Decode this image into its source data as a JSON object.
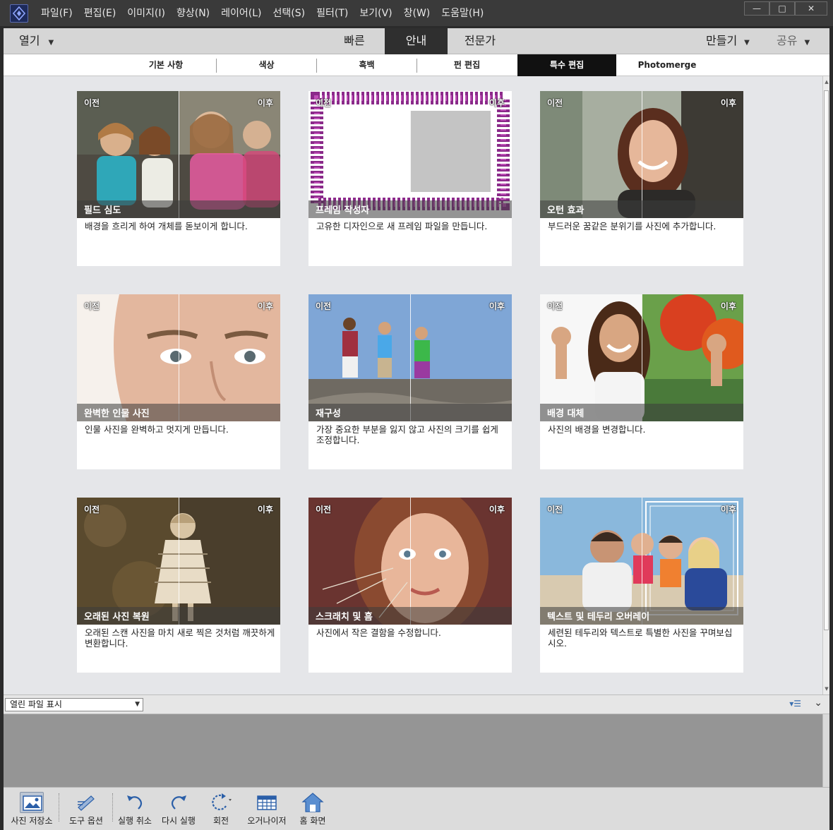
{
  "menu": [
    "파일(F)",
    "편집(E)",
    "이미지(I)",
    "향상(N)",
    "레이어(L)",
    "선택(S)",
    "필터(T)",
    "보기(V)",
    "창(W)",
    "도움말(H)"
  ],
  "window_controls": {
    "minimize": "—",
    "maximize": "□",
    "close": "✕"
  },
  "modebar": {
    "open": "열기",
    "tabs": [
      "빠른",
      "안내",
      "전문가"
    ],
    "active_tab": "안내",
    "create": "만들기",
    "share": "공유"
  },
  "subtabs": [
    "기본 사항",
    "색상",
    "흑백",
    "펀 편집",
    "특수 편집",
    "Photomerge"
  ],
  "active_subtab": "특수 편집",
  "card_labels": {
    "before": "이전",
    "after": "이후"
  },
  "cards": [
    {
      "title": "필드 심도",
      "desc": "배경을 흐리게 하여 개체를 돋보이게 합니다."
    },
    {
      "title": "프레임 작성자",
      "desc": "고유한 디자인으로 새 프레임 파일을 만듭니다."
    },
    {
      "title": "오턴 효과",
      "desc": "부드러운 꿈같은 분위기를 사진에 추가합니다."
    },
    {
      "title": "완벽한 인물 사진",
      "desc": "인물 사진을 완벽하고 멋지게 만듭니다."
    },
    {
      "title": "재구성",
      "desc": "가장 중요한 부분을 잃지 않고 사진의 크기를 쉽게 조정합니다."
    },
    {
      "title": "배경 대체",
      "desc": "사진의 배경을 변경합니다."
    },
    {
      "title": "오래된 사진 복원",
      "desc": "오래된 스캔 사진을 마치 새로 찍은 것처럼 깨끗하게 변환합니다."
    },
    {
      "title": "스크래치 및 흠",
      "desc": "사진에서 작은 결함을 수정합니다."
    },
    {
      "title": "텍스트 및 테두리 오버레이",
      "desc": "세련된 테두리와 텍스트로 특별한 사진을 꾸며보십시오."
    }
  ],
  "bin": {
    "select_value": "열린 파일 표시"
  },
  "toolbar": {
    "photo_bin": "사진 저장소",
    "tool_options": "도구 옵션",
    "undo": "실행 취소",
    "redo": "다시 실행",
    "rotate": "회전",
    "organizer": "오거나이저",
    "home": "홈 화면"
  },
  "icons": [
    "app-icon",
    "photo-bin-icon",
    "tool-options-icon",
    "undo-icon",
    "redo-icon",
    "rotate-icon",
    "organizer-icon",
    "home-icon"
  ]
}
